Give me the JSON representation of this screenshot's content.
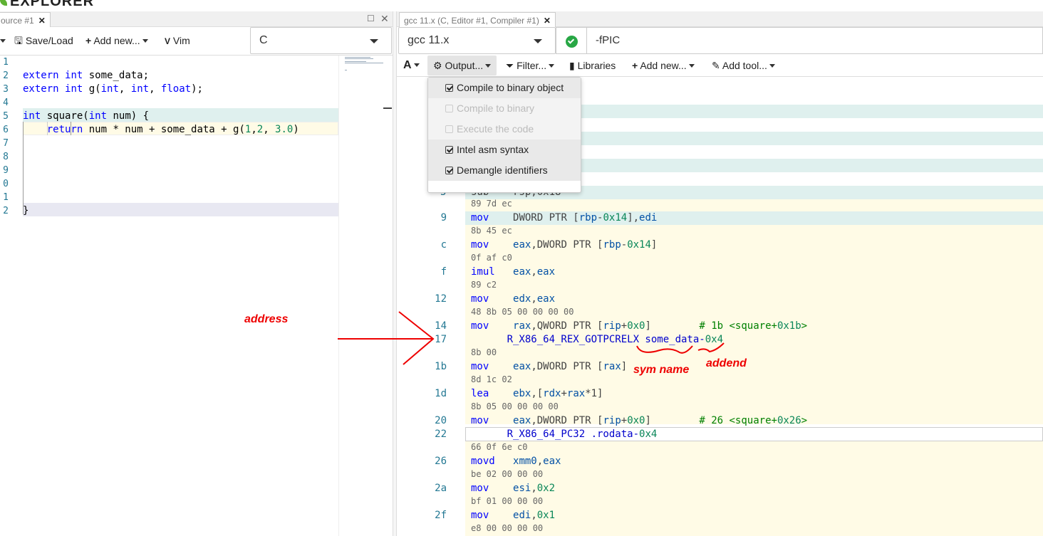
{
  "app": {
    "logo_text": "EXPLORER"
  },
  "source_pane": {
    "tab_label": "ource #1",
    "toolbar": {
      "save_load": "Save/Load",
      "add_new": "Add new...",
      "vim": "Vim"
    },
    "language": "C",
    "lines": [
      {
        "n": "1",
        "text": ""
      },
      {
        "n": "2",
        "text": "extern int some_data;"
      },
      {
        "n": "3",
        "text": "extern int g(int, int, float);"
      },
      {
        "n": "4",
        "text": ""
      },
      {
        "n": "5",
        "text": "int square(int num) {"
      },
      {
        "n": "6",
        "text": "    return num * num + some_data + g(1,2, 3.0)"
      },
      {
        "n": "7",
        "text": ""
      },
      {
        "n": "8",
        "text": ""
      },
      {
        "n": "9",
        "text": ""
      },
      {
        "n": "0",
        "text": ""
      },
      {
        "n": "1",
        "text": ""
      },
      {
        "n": "2",
        "text": "}"
      }
    ]
  },
  "compiler_pane": {
    "tab_label": "gcc 11.x (C, Editor #1, Compiler #1)",
    "compiler": "gcc 11.x",
    "options": "-fPIC",
    "toolbar": {
      "output": "Output...",
      "filter": "Filter...",
      "libraries": "Libraries",
      "add_new": "Add new...",
      "add_tool": "Add tool..."
    },
    "output_menu": [
      {
        "label": "Compile to binary object",
        "checked": true,
        "disabled": false
      },
      {
        "label": "Compile to binary",
        "checked": false,
        "disabled": true
      },
      {
        "label": "Execute the code",
        "checked": false,
        "disabled": true
      },
      {
        "label": "Intel asm syntax",
        "checked": true,
        "disabled": false
      },
      {
        "label": "Demangle identifiers",
        "checked": true,
        "disabled": false
      }
    ],
    "asm": [
      {
        "opcodes": "89 7d ec",
        "addr": "9",
        "text": "mov    DWORD PTR [rbp-0x14],edi"
      },
      {
        "opcodes": "8b 45 ec",
        "addr": "c",
        "text": "mov    eax,DWORD PTR [rbp-0x14]"
      },
      {
        "opcodes": "0f af c0",
        "addr": "f",
        "text": "imul   eax,eax"
      },
      {
        "opcodes": "89 c2",
        "addr": "12",
        "text": "mov    edx,eax"
      },
      {
        "opcodes": "48 8b 05 00 00 00 00",
        "addr": "14",
        "text": "mov    rax,QWORD PTR [rip+0x0]        # 1b <square+0x1b>"
      },
      {
        "opcodes": "",
        "addr": "17",
        "text": "      R_X86_64_REX_GOTPCRELX some_data-0x4"
      },
      {
        "opcodes": "8b 00",
        "addr": "1b",
        "text": "mov    eax,DWORD PTR [rax]"
      },
      {
        "opcodes": "8d 1c 02",
        "addr": "1d",
        "text": "lea    ebx,[rdx+rax*1]"
      },
      {
        "opcodes": "8b 05 00 00 00 00",
        "addr": "20",
        "text": "mov    eax,DWORD PTR [rip+0x0]        # 26 <square+0x26>"
      },
      {
        "opcodes": "",
        "addr": "22",
        "text": "      R_X86_64_PC32 .rodata-0x4"
      },
      {
        "opcodes": "66 0f 6e c0",
        "addr": "26",
        "text": "movd   xmm0,eax"
      },
      {
        "opcodes": "be 02 00 00 00",
        "addr": "2a",
        "text": "mov    esi,0x2"
      },
      {
        "opcodes": "bf 01 00 00 00",
        "addr": "2f",
        "text": "mov    edi,0x1"
      },
      {
        "opcodes": "e8 00 00 00 00",
        "addr": "",
        "text": ""
      }
    ]
  },
  "annotations": {
    "address": "address",
    "sym_name": "sym name",
    "addend": "addend"
  },
  "colors": {
    "accent_red": "#ee0000",
    "highlight_teal": "#dff0ee",
    "highlight_yellow": "#fffbe6",
    "logo_purple": "#6b1fb1"
  }
}
